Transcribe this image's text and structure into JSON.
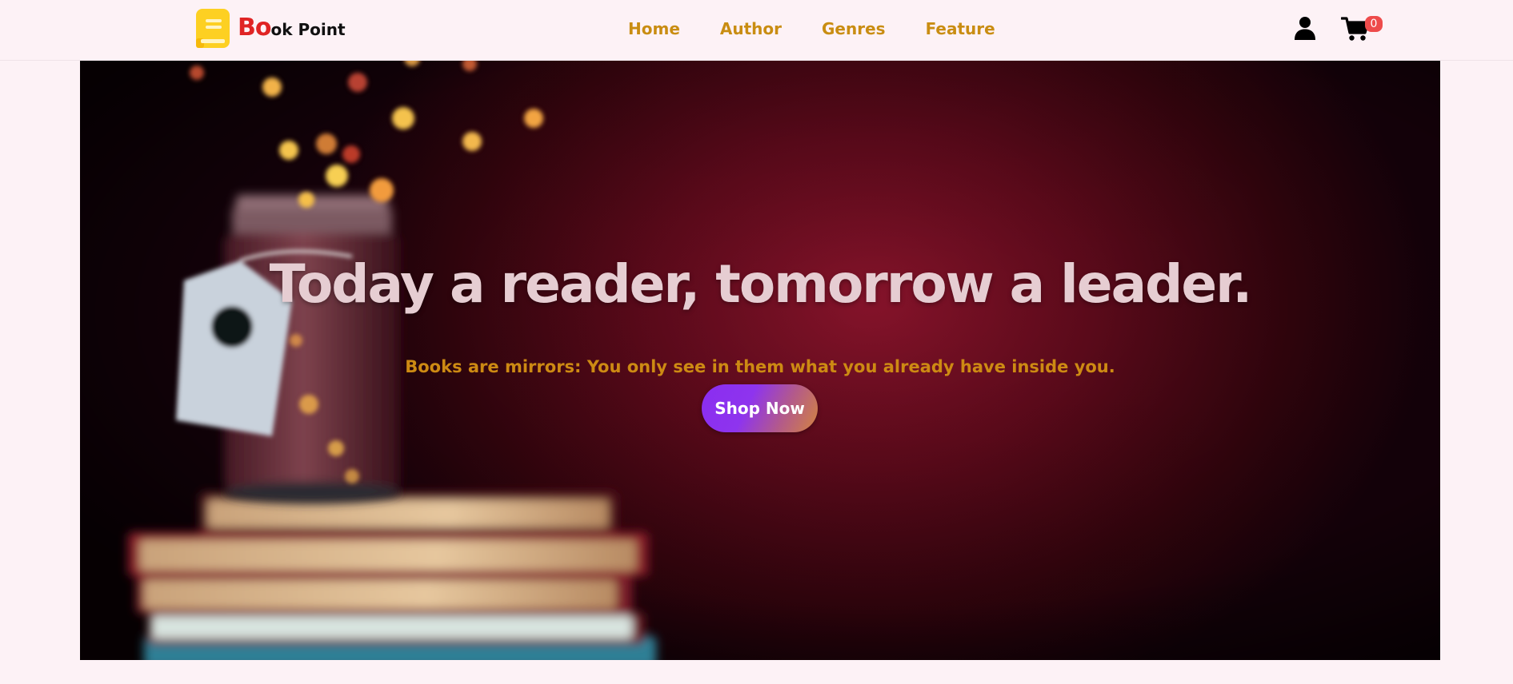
{
  "header": {
    "logo": {
      "icon": "book-icon",
      "text_highlight": "Bo",
      "text_rest": "ok Point",
      "icon_color": "#fdd022",
      "highlight_color": "#e02424"
    },
    "nav": [
      {
        "label": "Home"
      },
      {
        "label": "Author"
      },
      {
        "label": "Genres"
      },
      {
        "label": "Feature"
      }
    ],
    "nav_color": "#c98d12",
    "user_icon": "user-icon",
    "cart": {
      "icon": "cart-icon",
      "count": "0",
      "badge_color": "#ee4b4b"
    }
  },
  "hero": {
    "title": "Today a reader, tomorrow a leader.",
    "subtitle": "Books are mirrors: You only see in them what you already have inside you.",
    "cta_label": "Shop Now",
    "background_color": "#6a0b1e",
    "subtitle_color": "#cd8a13"
  }
}
